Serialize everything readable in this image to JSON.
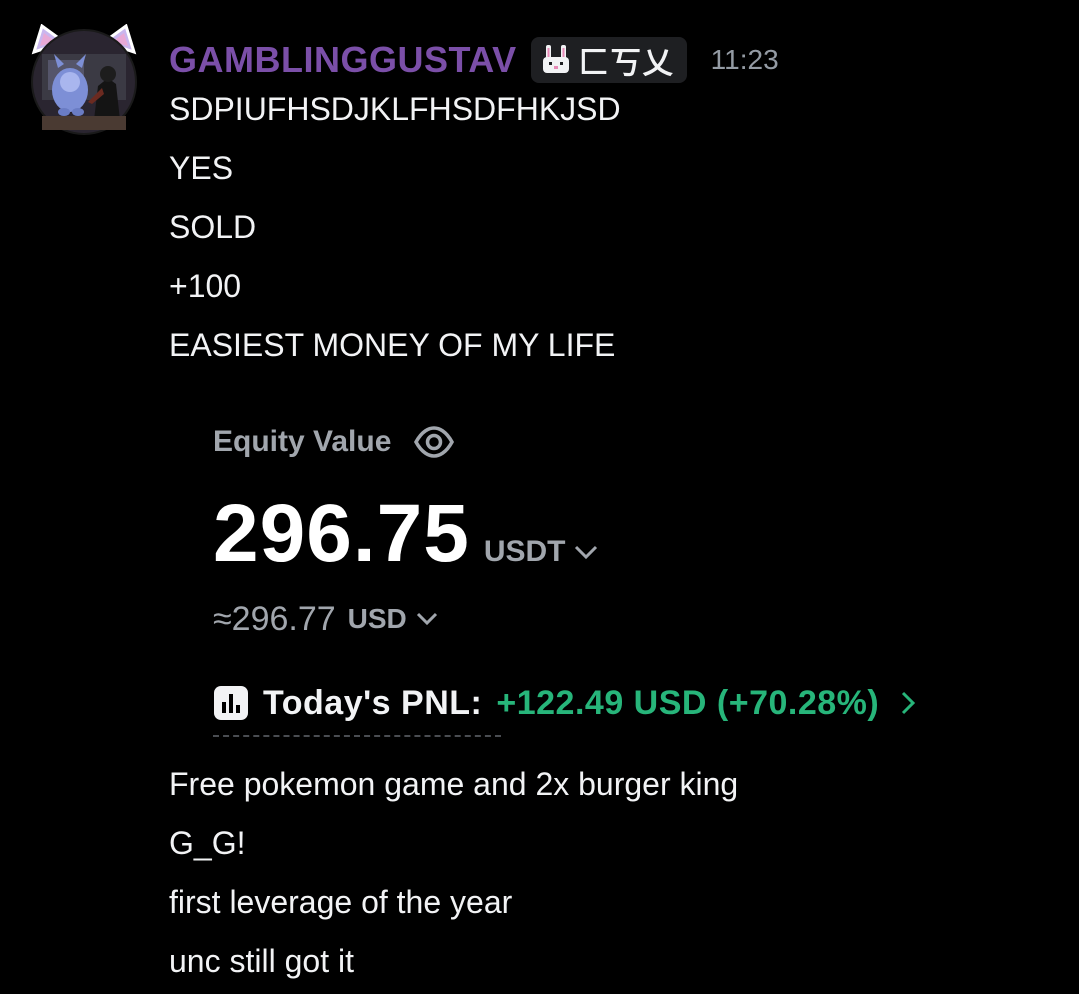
{
  "message": {
    "username": "GAMBLINGGUSTAV",
    "clan_tag": "匚丂乂",
    "clan_icon": "rabbit-icon",
    "timestamp": "11:23",
    "lines_before": [
      "SDPIUFHSDJKLFHSDFHKJSD",
      "YES",
      "SOLD",
      "+100",
      "EASIEST MONEY OF MY LIFE"
    ],
    "lines_after": [
      "Free pokemon game and 2x burger king",
      "G_G!",
      "first leverage of the year",
      "unc still got it"
    ]
  },
  "equity_card": {
    "label": "Equity Value",
    "label_icon": "eye-icon",
    "value": "296.75",
    "unit": "USDT",
    "approx_value": "≈296.77",
    "approx_unit": "USD",
    "pnl_icon": "bar-chart-icon",
    "pnl_label": "Today's PNL:",
    "pnl_value": "+122.49 USD (+70.28%)"
  },
  "colors": {
    "background": "#000000",
    "username": "#7b4fa8",
    "text": "#f2f3f5",
    "muted": "#a1a6ad",
    "timestamp": "#949ba4",
    "positive": "#27b57a"
  }
}
